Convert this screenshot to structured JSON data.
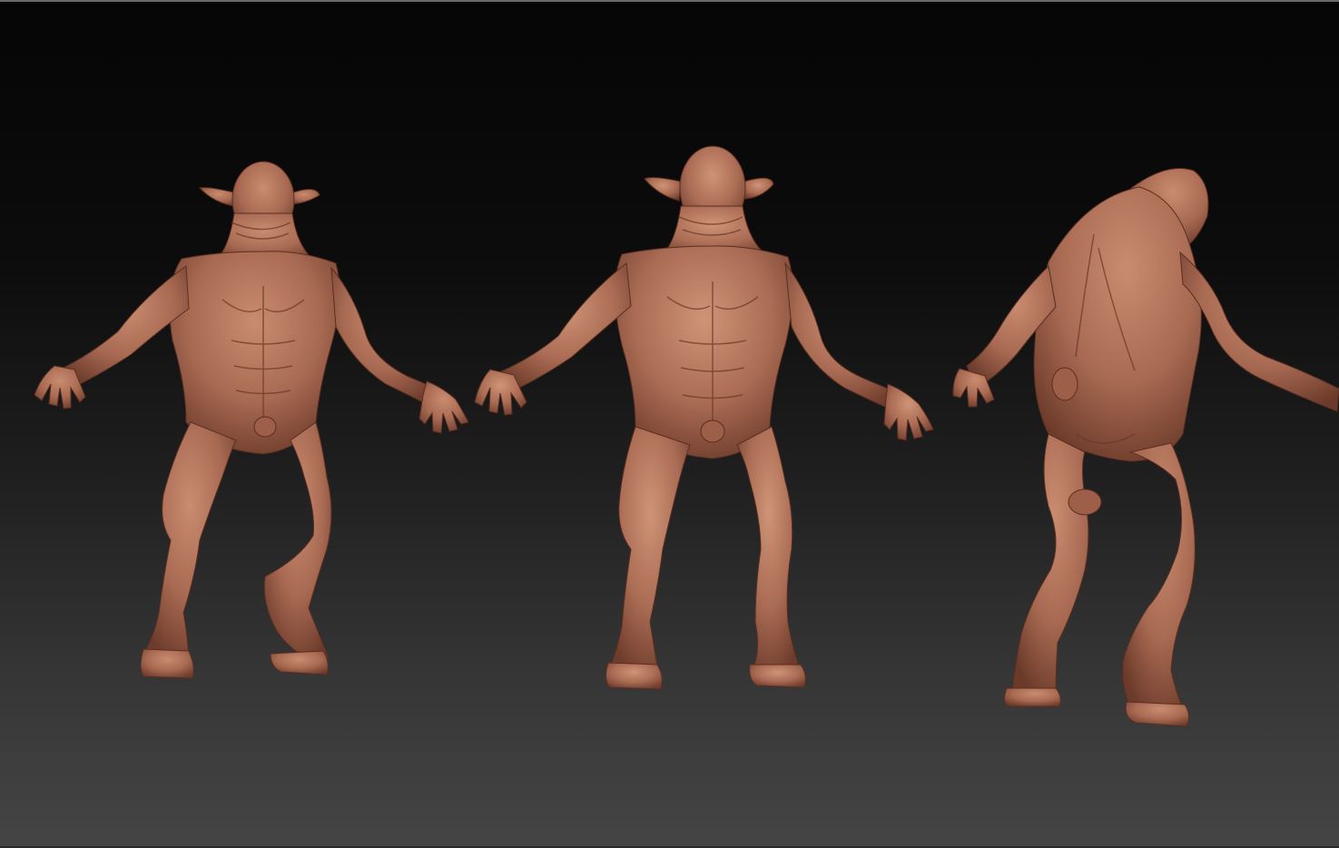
{
  "scene": {
    "background_top": "#050505",
    "background_bottom": "#454545",
    "material_color": "#a86a52",
    "material_shade": "#6e3c2c",
    "material_highlight": "#cf9478"
  },
  "models": [
    {
      "id": "model-front-left",
      "view": "front"
    },
    {
      "id": "model-front-center",
      "view": "front"
    },
    {
      "id": "model-back-right",
      "view": "back-three-quarter"
    }
  ]
}
